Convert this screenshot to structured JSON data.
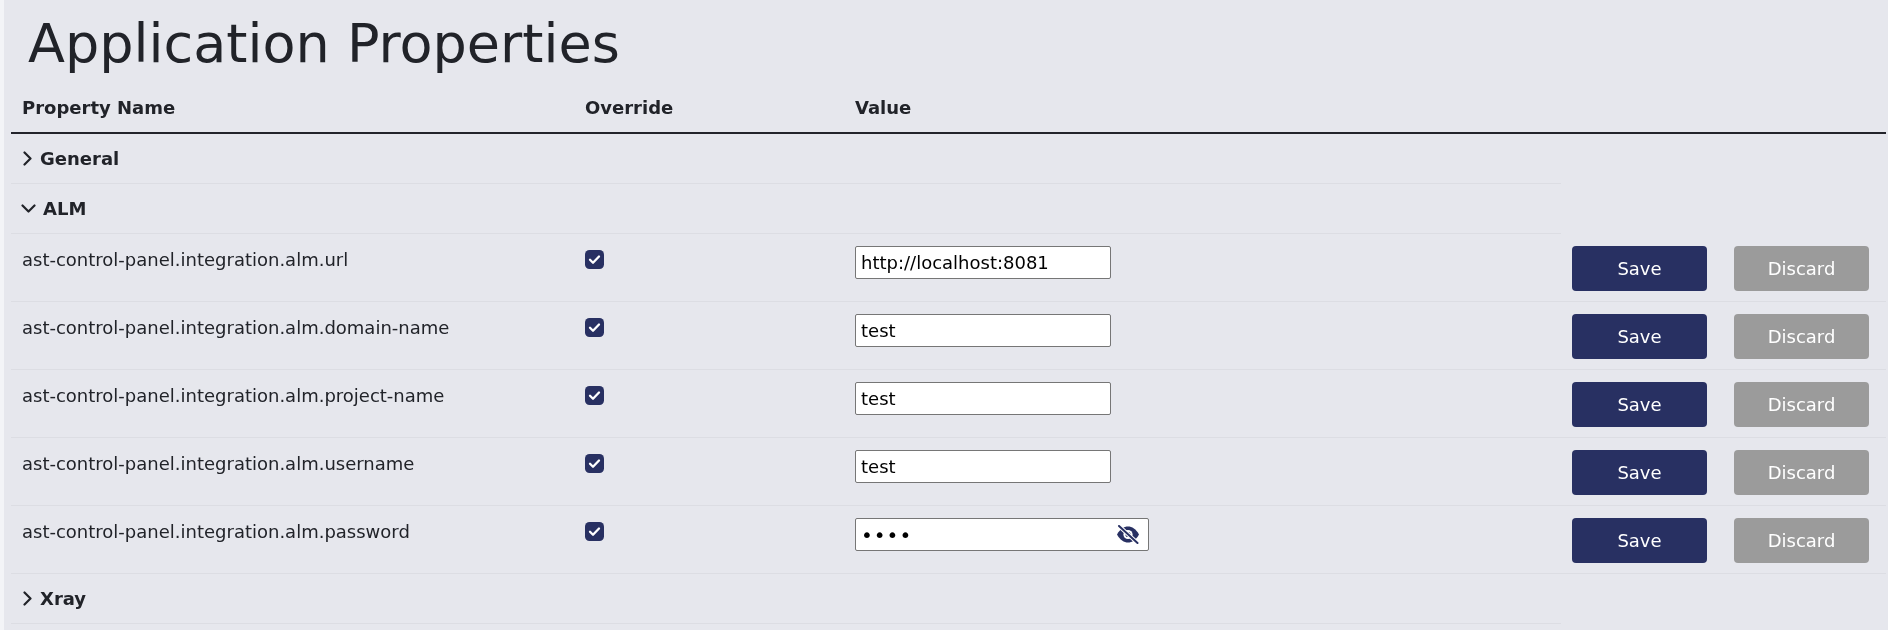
{
  "page": {
    "title": "Application Properties"
  },
  "table": {
    "columns": [
      "Property Name",
      "Override",
      "Value"
    ],
    "groups": [
      {
        "name": "General",
        "expanded": false
      },
      {
        "name": "ALM",
        "expanded": true,
        "properties": [
          {
            "name": "ast-control-panel.integration.alm.url",
            "override": true,
            "kind": "text",
            "value": "http://localhost:8081",
            "buttons": [
              {
                "label": "Save",
                "disabled": false
              },
              {
                "label": "Discard",
                "disabled": true
              }
            ]
          },
          {
            "name": "ast-control-panel.integration.alm.domain-name",
            "override": true,
            "kind": "text",
            "value": "test",
            "buttons": [
              {
                "label": "Save",
                "disabled": false
              },
              {
                "label": "Discard",
                "disabled": true
              }
            ]
          },
          {
            "name": "ast-control-panel.integration.alm.project-name",
            "override": true,
            "kind": "text",
            "value": "test",
            "buttons": [
              {
                "label": "Save",
                "disabled": false
              },
              {
                "label": "Discard",
                "disabled": true
              }
            ]
          },
          {
            "name": "ast-control-panel.integration.alm.username",
            "override": true,
            "kind": "text",
            "value": "test",
            "buttons": [
              {
                "label": "Save",
                "disabled": false
              },
              {
                "label": "Discard",
                "disabled": true
              }
            ]
          },
          {
            "name": "ast-control-panel.integration.alm.password",
            "override": true,
            "kind": "password",
            "value": "••••",
            "buttons": [
              {
                "label": "Save",
                "disabled": false
              },
              {
                "label": "Discard",
                "disabled": true
              }
            ]
          }
        ]
      },
      {
        "name": "Xray",
        "expanded": false
      }
    ]
  }
}
